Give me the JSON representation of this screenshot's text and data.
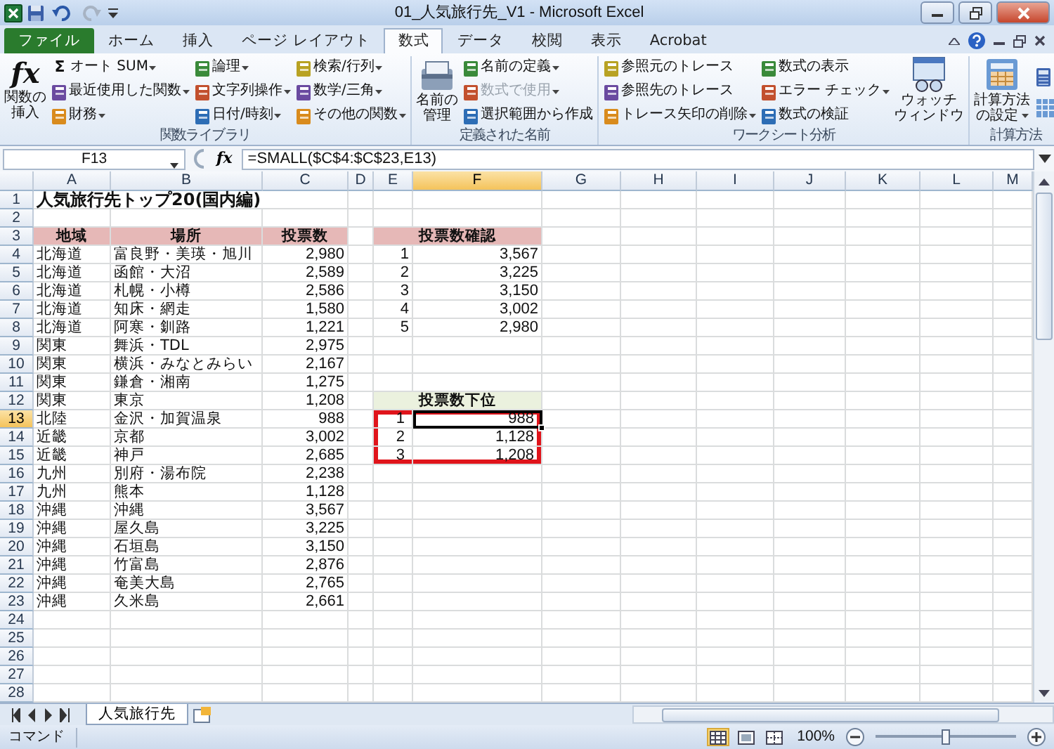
{
  "window": {
    "title": "01_人気旅行先_V1 - Microsoft Excel",
    "redo_disabled": true
  },
  "tabs": [
    {
      "label": "ファイル",
      "kind": "file",
      "selected": false
    },
    {
      "label": "ホーム",
      "kind": "tab",
      "selected": false
    },
    {
      "label": "挿入",
      "kind": "tab",
      "selected": false
    },
    {
      "label": "ページ レイアウト",
      "kind": "tab",
      "selected": false
    },
    {
      "label": "数式",
      "kind": "tab",
      "selected": true
    },
    {
      "label": "データ",
      "kind": "tab",
      "selected": false
    },
    {
      "label": "校閲",
      "kind": "tab",
      "selected": false
    },
    {
      "label": "表示",
      "kind": "tab",
      "selected": false
    },
    {
      "label": "Acrobat",
      "kind": "tab",
      "selected": false
    }
  ],
  "ribbon": [
    {
      "label": "関数ライブラリ",
      "items": [
        {
          "kind": "large",
          "glyph": "fx",
          "lines": [
            "関数の",
            "挿入"
          ],
          "dropdown": false
        },
        {
          "kind": "stack",
          "buttons": [
            {
              "label": "オート SUM",
              "glyph": "Σ",
              "dropdown": true,
              "disabled": false
            },
            {
              "label": "最近使用した関数",
              "dropdown": true,
              "disabled": false
            },
            {
              "label": "財務",
              "dropdown": true,
              "disabled": false
            }
          ]
        },
        {
          "kind": "stack",
          "buttons": [
            {
              "label": "論理",
              "dropdown": true,
              "disabled": false
            },
            {
              "label": "文字列操作",
              "dropdown": true,
              "disabled": false
            },
            {
              "label": "日付/時刻",
              "dropdown": true,
              "disabled": false
            }
          ]
        },
        {
          "kind": "stack",
          "buttons": [
            {
              "label": "検索/行列",
              "dropdown": true,
              "disabled": false
            },
            {
              "label": "数学/三角",
              "dropdown": true,
              "disabled": false
            },
            {
              "label": "その他の関数",
              "dropdown": true,
              "disabled": false
            }
          ]
        }
      ]
    },
    {
      "label": "定義された名前",
      "items": [
        {
          "kind": "large",
          "lines": [
            "名前の",
            "管理"
          ],
          "dropdown": false
        },
        {
          "kind": "stack",
          "buttons": [
            {
              "label": "名前の定義",
              "dropdown": true,
              "disabled": false
            },
            {
              "label": "数式で使用",
              "dropdown": true,
              "disabled": true
            },
            {
              "label": "選択範囲から作成",
              "dropdown": false,
              "disabled": false
            }
          ]
        }
      ]
    },
    {
      "label": "ワークシート分析",
      "items": [
        {
          "kind": "stack",
          "buttons": [
            {
              "label": "参照元のトレース",
              "dropdown": false,
              "disabled": false
            },
            {
              "label": "参照先のトレース",
              "dropdown": false,
              "disabled": false
            },
            {
              "label": "トレース矢印の削除",
              "dropdown": true,
              "disabled": false
            }
          ]
        },
        {
          "kind": "stack",
          "buttons": [
            {
              "label": "数式の表示",
              "dropdown": false,
              "disabled": false
            },
            {
              "label": "エラー チェック",
              "dropdown": true,
              "disabled": false
            },
            {
              "label": "数式の検証",
              "dropdown": false,
              "disabled": false
            }
          ]
        },
        {
          "kind": "large",
          "lines": [
            "ウォッチ",
            "ウィンドウ"
          ],
          "dropdown": false
        }
      ]
    },
    {
      "label": "計算方法",
      "items": [
        {
          "kind": "large",
          "lines": [
            "計算方法",
            "の設定"
          ],
          "dropdown": true
        },
        {
          "kind": "icons"
        }
      ]
    }
  ],
  "formula_bar": {
    "name_box": "F13",
    "function_glyph": "fx",
    "formula": "=SMALL($C$4:$C$23,E13)"
  },
  "sheet": {
    "columns": [
      "A",
      "B",
      "C",
      "D",
      "E",
      "F",
      "G",
      "H",
      "I",
      "J",
      "K",
      "L",
      "M"
    ],
    "rows": [
      {
        "header": "1",
        "cells": {
          "A": {
            "kind": "title",
            "text": "人気旅行先トップ20(国内編)"
          }
        }
      },
      {
        "header": "2"
      },
      {
        "header": "3",
        "cells": {
          "A": {
            "kind": "header",
            "text": "地域",
            "color": "#e6b8b7"
          },
          "B": {
            "kind": "header",
            "text": "場所",
            "color": "#e6b8b7"
          },
          "C": {
            "kind": "header",
            "text": "投票数",
            "color": "#e6b8b7"
          },
          "E": {
            "kind": "header",
            "merged_right": true,
            "text": "投票数確認",
            "color": "#e6b8b7"
          }
        }
      },
      {
        "header": "4",
        "cells": {
          "A": {
            "kind": "text",
            "text": "北海道"
          },
          "B": {
            "kind": "text",
            "text": "富良野・美瑛・旭川"
          },
          "C": {
            "kind": "number",
            "text": "2,980"
          },
          "E": {
            "kind": "number",
            "text": "1"
          },
          "F": {
            "kind": "number",
            "text": "3,567"
          }
        }
      },
      {
        "header": "5",
        "cells": {
          "A": {
            "kind": "text",
            "text": "北海道"
          },
          "B": {
            "kind": "text",
            "text": "函館・大沼"
          },
          "C": {
            "kind": "number",
            "text": "2,589"
          },
          "E": {
            "kind": "number",
            "text": "2"
          },
          "F": {
            "kind": "number",
            "text": "3,225"
          }
        }
      },
      {
        "header": "6",
        "cells": {
          "A": {
            "kind": "text",
            "text": "北海道"
          },
          "B": {
            "kind": "text",
            "text": "札幌・小樽"
          },
          "C": {
            "kind": "number",
            "text": "2,586"
          },
          "E": {
            "kind": "number",
            "text": "3"
          },
          "F": {
            "kind": "number",
            "text": "3,150"
          }
        }
      },
      {
        "header": "7",
        "cells": {
          "A": {
            "kind": "text",
            "text": "北海道"
          },
          "B": {
            "kind": "text",
            "text": "知床・網走"
          },
          "C": {
            "kind": "number",
            "text": "1,580"
          },
          "E": {
            "kind": "number",
            "text": "4"
          },
          "F": {
            "kind": "number",
            "text": "3,002"
          }
        }
      },
      {
        "header": "8",
        "cells": {
          "A": {
            "kind": "text",
            "text": "北海道"
          },
          "B": {
            "kind": "text",
            "text": "阿寒・釧路"
          },
          "C": {
            "kind": "number",
            "text": "1,221"
          },
          "E": {
            "kind": "number",
            "text": "5"
          },
          "F": {
            "kind": "number",
            "text": "2,980"
          }
        }
      },
      {
        "header": "9",
        "cells": {
          "A": {
            "kind": "text",
            "text": "関東"
          },
          "B": {
            "kind": "text",
            "text": "舞浜・TDL"
          },
          "C": {
            "kind": "number",
            "text": "2,975"
          }
        }
      },
      {
        "header": "10",
        "cells": {
          "A": {
            "kind": "text",
            "text": "関東"
          },
          "B": {
            "kind": "text",
            "text": "横浜・みなとみらい"
          },
          "C": {
            "kind": "number",
            "text": "2,167"
          }
        }
      },
      {
        "header": "11",
        "cells": {
          "A": {
            "kind": "text",
            "text": "関東"
          },
          "B": {
            "kind": "text",
            "text": "鎌倉・湘南"
          },
          "C": {
            "kind": "number",
            "text": "1,275"
          }
        }
      },
      {
        "header": "12",
        "cells": {
          "A": {
            "kind": "text",
            "text": "関東"
          },
          "B": {
            "kind": "text",
            "text": "東京"
          },
          "C": {
            "kind": "number",
            "text": "1,208"
          },
          "E": {
            "kind": "header",
            "merged_right": true,
            "text": "投票数下位",
            "color": "#ebf1de"
          }
        }
      },
      {
        "header": "13",
        "cells": {
          "A": {
            "kind": "text",
            "text": "北陸"
          },
          "B": {
            "kind": "text",
            "text": "金沢・加賀温泉"
          },
          "C": {
            "kind": "number",
            "text": "988"
          },
          "E": {
            "kind": "number",
            "text": "1",
            "framed": true
          },
          "F": {
            "kind": "number",
            "text": "988",
            "selected": true,
            "framed": true
          }
        }
      },
      {
        "header": "14",
        "cells": {
          "A": {
            "kind": "text",
            "text": "近畿"
          },
          "B": {
            "kind": "text",
            "text": "京都"
          },
          "C": {
            "kind": "number",
            "text": "3,002"
          },
          "E": {
            "kind": "number",
            "text": "2",
            "framed": true
          },
          "F": {
            "kind": "number",
            "text": "1,128",
            "framed": true
          }
        }
      },
      {
        "header": "15",
        "cells": {
          "A": {
            "kind": "text",
            "text": "近畿"
          },
          "B": {
            "kind": "text",
            "text": "神戸"
          },
          "C": {
            "kind": "number",
            "text": "2,685"
          },
          "E": {
            "kind": "number",
            "text": "3",
            "framed": true
          },
          "F": {
            "kind": "number",
            "text": "1,208",
            "framed": true
          }
        }
      },
      {
        "header": "16",
        "cells": {
          "A": {
            "kind": "text",
            "text": "九州"
          },
          "B": {
            "kind": "text",
            "text": "別府・湯布院"
          },
          "C": {
            "kind": "number",
            "text": "2,238"
          }
        }
      },
      {
        "header": "17",
        "cells": {
          "A": {
            "kind": "text",
            "text": "九州"
          },
          "B": {
            "kind": "text",
            "text": "熊本"
          },
          "C": {
            "kind": "number",
            "text": "1,128"
          }
        }
      },
      {
        "header": "18",
        "cells": {
          "A": {
            "kind": "text",
            "text": "沖縄"
          },
          "B": {
            "kind": "text",
            "text": "沖縄"
          },
          "C": {
            "kind": "number",
            "text": "3,567"
          }
        }
      },
      {
        "header": "19",
        "cells": {
          "A": {
            "kind": "text",
            "text": "沖縄"
          },
          "B": {
            "kind": "text",
            "text": "屋久島"
          },
          "C": {
            "kind": "number",
            "text": "3,225"
          }
        }
      },
      {
        "header": "20",
        "cells": {
          "A": {
            "kind": "text",
            "text": "沖縄"
          },
          "B": {
            "kind": "text",
            "text": "石垣島"
          },
          "C": {
            "kind": "number",
            "text": "3,150"
          }
        }
      },
      {
        "header": "21",
        "cells": {
          "A": {
            "kind": "text",
            "text": "沖縄"
          },
          "B": {
            "kind": "text",
            "text": "竹富島"
          },
          "C": {
            "kind": "number",
            "text": "2,876"
          }
        }
      },
      {
        "header": "22",
        "cells": {
          "A": {
            "kind": "text",
            "text": "沖縄"
          },
          "B": {
            "kind": "text",
            "text": "奄美大島"
          },
          "C": {
            "kind": "number",
            "text": "2,765"
          }
        }
      },
      {
        "header": "23",
        "cells": {
          "A": {
            "kind": "text",
            "text": "沖縄"
          },
          "B": {
            "kind": "text",
            "text": "久米島"
          },
          "C": {
            "kind": "number",
            "text": "2,661"
          }
        }
      },
      {
        "header": "24"
      },
      {
        "header": "25"
      },
      {
        "header": "26"
      },
      {
        "header": "27"
      },
      {
        "header": "28"
      }
    ]
  },
  "sheet_tabs": [
    {
      "label": "人気旅行先",
      "selected": true
    }
  ],
  "status_bar": {
    "mode": "コマンド",
    "views": [
      {
        "selected": true
      },
      {
        "selected": false
      },
      {
        "selected": false
      }
    ],
    "zoom": "100%",
    "zoom_slider": {
      "level": 0.5
    }
  }
}
